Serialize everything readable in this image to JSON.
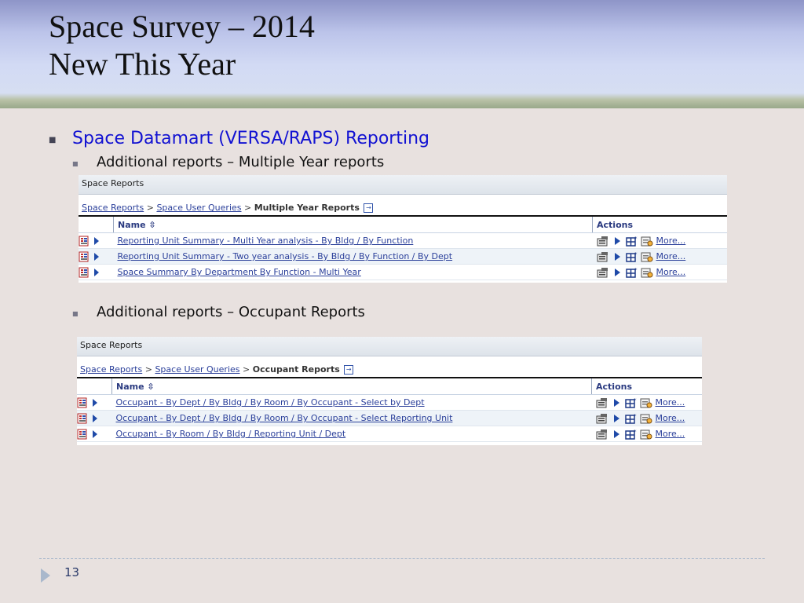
{
  "slide": {
    "title_line1": "Space Survey – 2014",
    "title_line2": "New This Year",
    "page_number": "13"
  },
  "bullets": {
    "level1": "Space Datamart (VERSA/RAPS) Reporting",
    "sub1": "Additional reports – Multiple Year reports",
    "sub2": "Additional reports – Occupant Reports"
  },
  "panels": [
    {
      "title": "Space Reports",
      "breadcrumb": [
        "Space Reports",
        "Space User Queries",
        "Multiple Year Reports"
      ],
      "name_header": "Name ⇳",
      "actions_header": "Actions",
      "rows": [
        {
          "name": "Reporting Unit Summary - Multi Year analysis - By Bldg / By Function",
          "more": "More..."
        },
        {
          "name": "Reporting Unit Summary - Two year analysis - By Bldg / By Function / By Dept",
          "more": "More..."
        },
        {
          "name": "Space Summary By Department By Function - Multi Year",
          "more": "More..."
        }
      ]
    },
    {
      "title": "Space Reports",
      "breadcrumb": [
        "Space Reports",
        "Space User Queries",
        "Occupant Reports"
      ],
      "name_header": "Name ⇳",
      "actions_header": "Actions",
      "rows": [
        {
          "name": "Occupant - By Dept / By Bldg / By Room / By Occupant - Select by Dept",
          "more": "More..."
        },
        {
          "name": "Occupant - By Dept / By Bldg / By Room / By Occupant - Select Reporting Unit",
          "more": "More..."
        },
        {
          "name": "Occupant - By Room / By Bldg / Reporting Unit / Dept",
          "more": "More..."
        }
      ]
    }
  ],
  "colors": {
    "bullet_blue": "#1212d2",
    "link_blue": "#2a3f9a",
    "header_gradient_top": "#8e95c8",
    "header_band_green": "#99a88a",
    "slide_background": "#e8e1df"
  },
  "icons": [
    "report-icon",
    "run-arrow-icon",
    "properties-icon",
    "run-options-icon",
    "schedule-icon",
    "open-new-window-icon",
    "slide-nav-arrow-icon"
  ]
}
